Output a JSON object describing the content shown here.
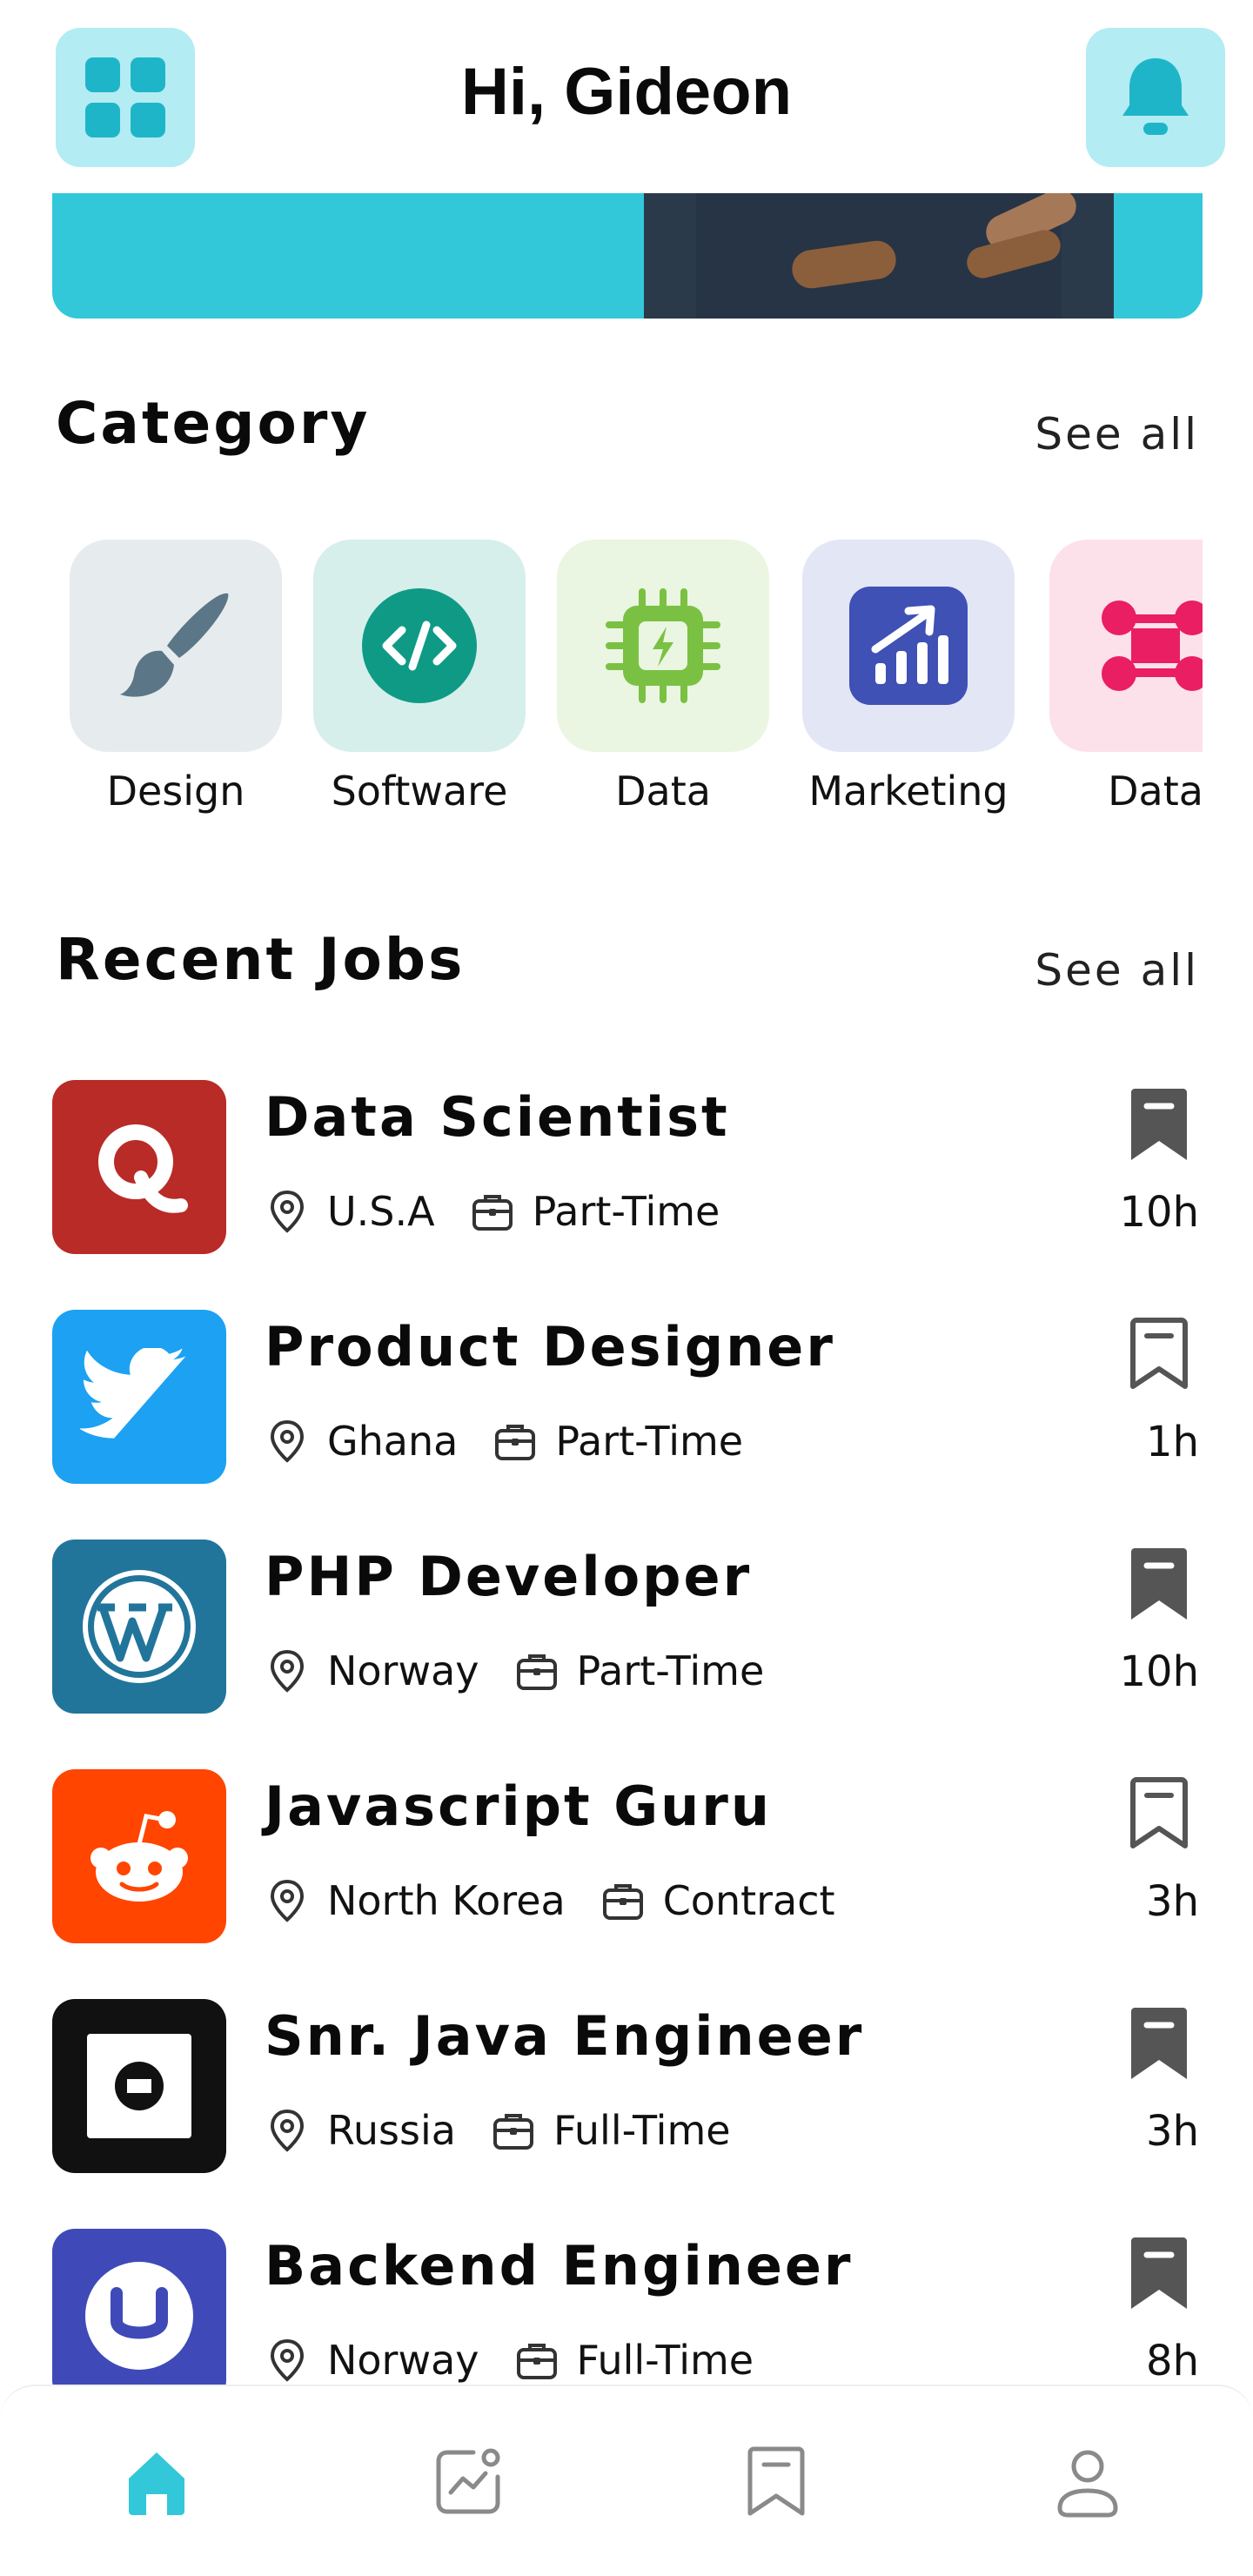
{
  "header": {
    "greeting": "Hi, Gideon"
  },
  "category": {
    "title": "Category",
    "see_all": "See all",
    "items": [
      {
        "label": "Design",
        "icon": "paintbrush-icon",
        "bg": "#e6ebee",
        "fg": "#5b7687"
      },
      {
        "label": "Software",
        "icon": "code-icon",
        "bg": "#d6efeb",
        "fg": "#0f9a86"
      },
      {
        "label": "Data",
        "icon": "chip-icon",
        "bg": "#eaf6e1",
        "fg": "#7ac143"
      },
      {
        "label": "Marketing",
        "icon": "growth-chart-icon",
        "bg": "#e3e6f5",
        "fg": "#3f51b5"
      },
      {
        "label": "Data",
        "icon": "network-icon",
        "bg": "#fde1ea",
        "fg": "#e91e63"
      }
    ]
  },
  "recent_jobs": {
    "title": "Recent Jobs",
    "see_all": "See all",
    "items": [
      {
        "title": "Data Scientist",
        "location": "U.S.A",
        "type": "Part-Time",
        "time": "10h",
        "saved": true,
        "logo": "quora-logo",
        "logo_bg": "#b92b27"
      },
      {
        "title": "Product Designer",
        "location": "Ghana",
        "type": "Part-Time",
        "time": "1h",
        "saved": false,
        "logo": "twitter-logo",
        "logo_bg": "#1da1f2"
      },
      {
        "title": "PHP Developer",
        "location": "Norway",
        "type": "Part-Time",
        "time": "10h",
        "saved": true,
        "logo": "wordpress-logo",
        "logo_bg": "#21759b"
      },
      {
        "title": "Javascript Guru",
        "location": "North Korea",
        "type": "Contract",
        "time": "3h",
        "saved": false,
        "logo": "reddit-logo",
        "logo_bg": "#ff4500"
      },
      {
        "title": "Snr. Java Engineer",
        "location": "Russia",
        "type": "Full-Time",
        "time": "3h",
        "saved": true,
        "logo": "uber-logo",
        "logo_bg": "#111111"
      },
      {
        "title": "Backend Engineer",
        "location": "Norway",
        "type": "Full-Time",
        "time": "8h",
        "saved": true,
        "logo": "udemy-logo",
        "logo_bg": "#3f4ab8"
      }
    ]
  },
  "colors": {
    "accent": "#33c7da",
    "accent_light": "#b3ecf3",
    "nav_inactive": "#8a8a8a"
  },
  "bottom_nav": [
    {
      "icon": "home-icon",
      "active": true
    },
    {
      "icon": "analytics-icon",
      "active": false
    },
    {
      "icon": "bookmark-icon",
      "active": false
    },
    {
      "icon": "profile-icon",
      "active": false
    }
  ]
}
